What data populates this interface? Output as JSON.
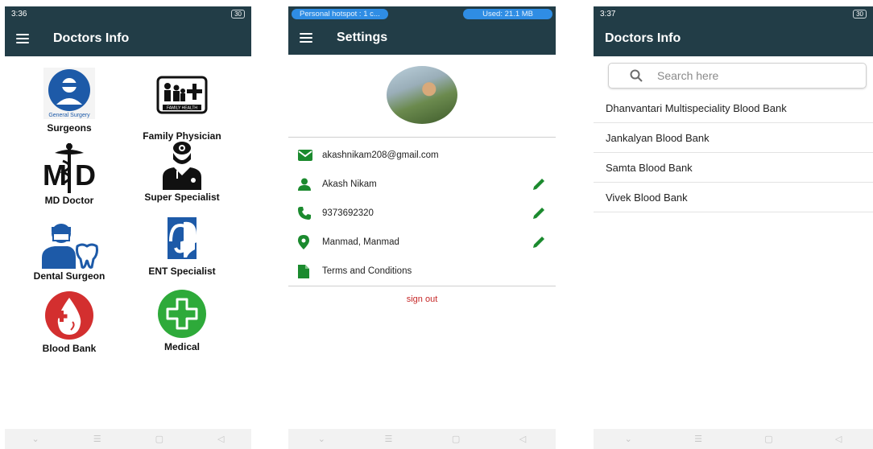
{
  "screen1": {
    "status": {
      "time": "3:36",
      "battery": "30"
    },
    "title": "Doctors Info",
    "categories": [
      {
        "label": "Surgeons",
        "icon": "general-surgery-icon",
        "icon_text": "General Surgery"
      },
      {
        "label": "Family Physician",
        "icon": "family-health-icon",
        "icon_text": "FAMILY HEALTH"
      },
      {
        "label": "MD Doctor",
        "icon": "md-caduceus-icon"
      },
      {
        "label": "Super Specialist",
        "icon": "doctor-stethoscope-icon"
      },
      {
        "label": "Dental Surgeon",
        "icon": "dentist-icon"
      },
      {
        "label": "ENT Specialist",
        "icon": "ent-icon"
      },
      {
        "label": "Blood Bank",
        "icon": "blood-drop-icon"
      },
      {
        "label": "Medical",
        "icon": "medical-cross-icon"
      }
    ]
  },
  "screen2": {
    "hotspot": {
      "left": "Personal hotspot : 1 c...",
      "right": "Used: 21.1 MB"
    },
    "title": "Settings",
    "rows": [
      {
        "text": "akashnikam208@gmail.com",
        "icon": "email-icon"
      },
      {
        "text": "Akash Nikam",
        "icon": "person-icon"
      },
      {
        "text": "9373692320",
        "icon": "phone-icon"
      },
      {
        "text": "Manmad, Manmad",
        "icon": "location-icon"
      },
      {
        "text": "Terms and Conditions",
        "icon": "document-icon"
      }
    ],
    "signout": "sign out"
  },
  "screen3": {
    "status": {
      "time": "3:37",
      "battery": "30"
    },
    "title": "Doctors Info",
    "search_placeholder": "Search here",
    "items": [
      "Dhanvantari Multispeciality Blood Bank",
      "Jankalyan Blood Bank",
      "Samta Blood Bank",
      "Vivek Blood Bank"
    ]
  },
  "colors": {
    "appbar": "#223d47",
    "green": "#1b8a2e",
    "signout": "#c62828",
    "pill": "#2f8de4"
  }
}
